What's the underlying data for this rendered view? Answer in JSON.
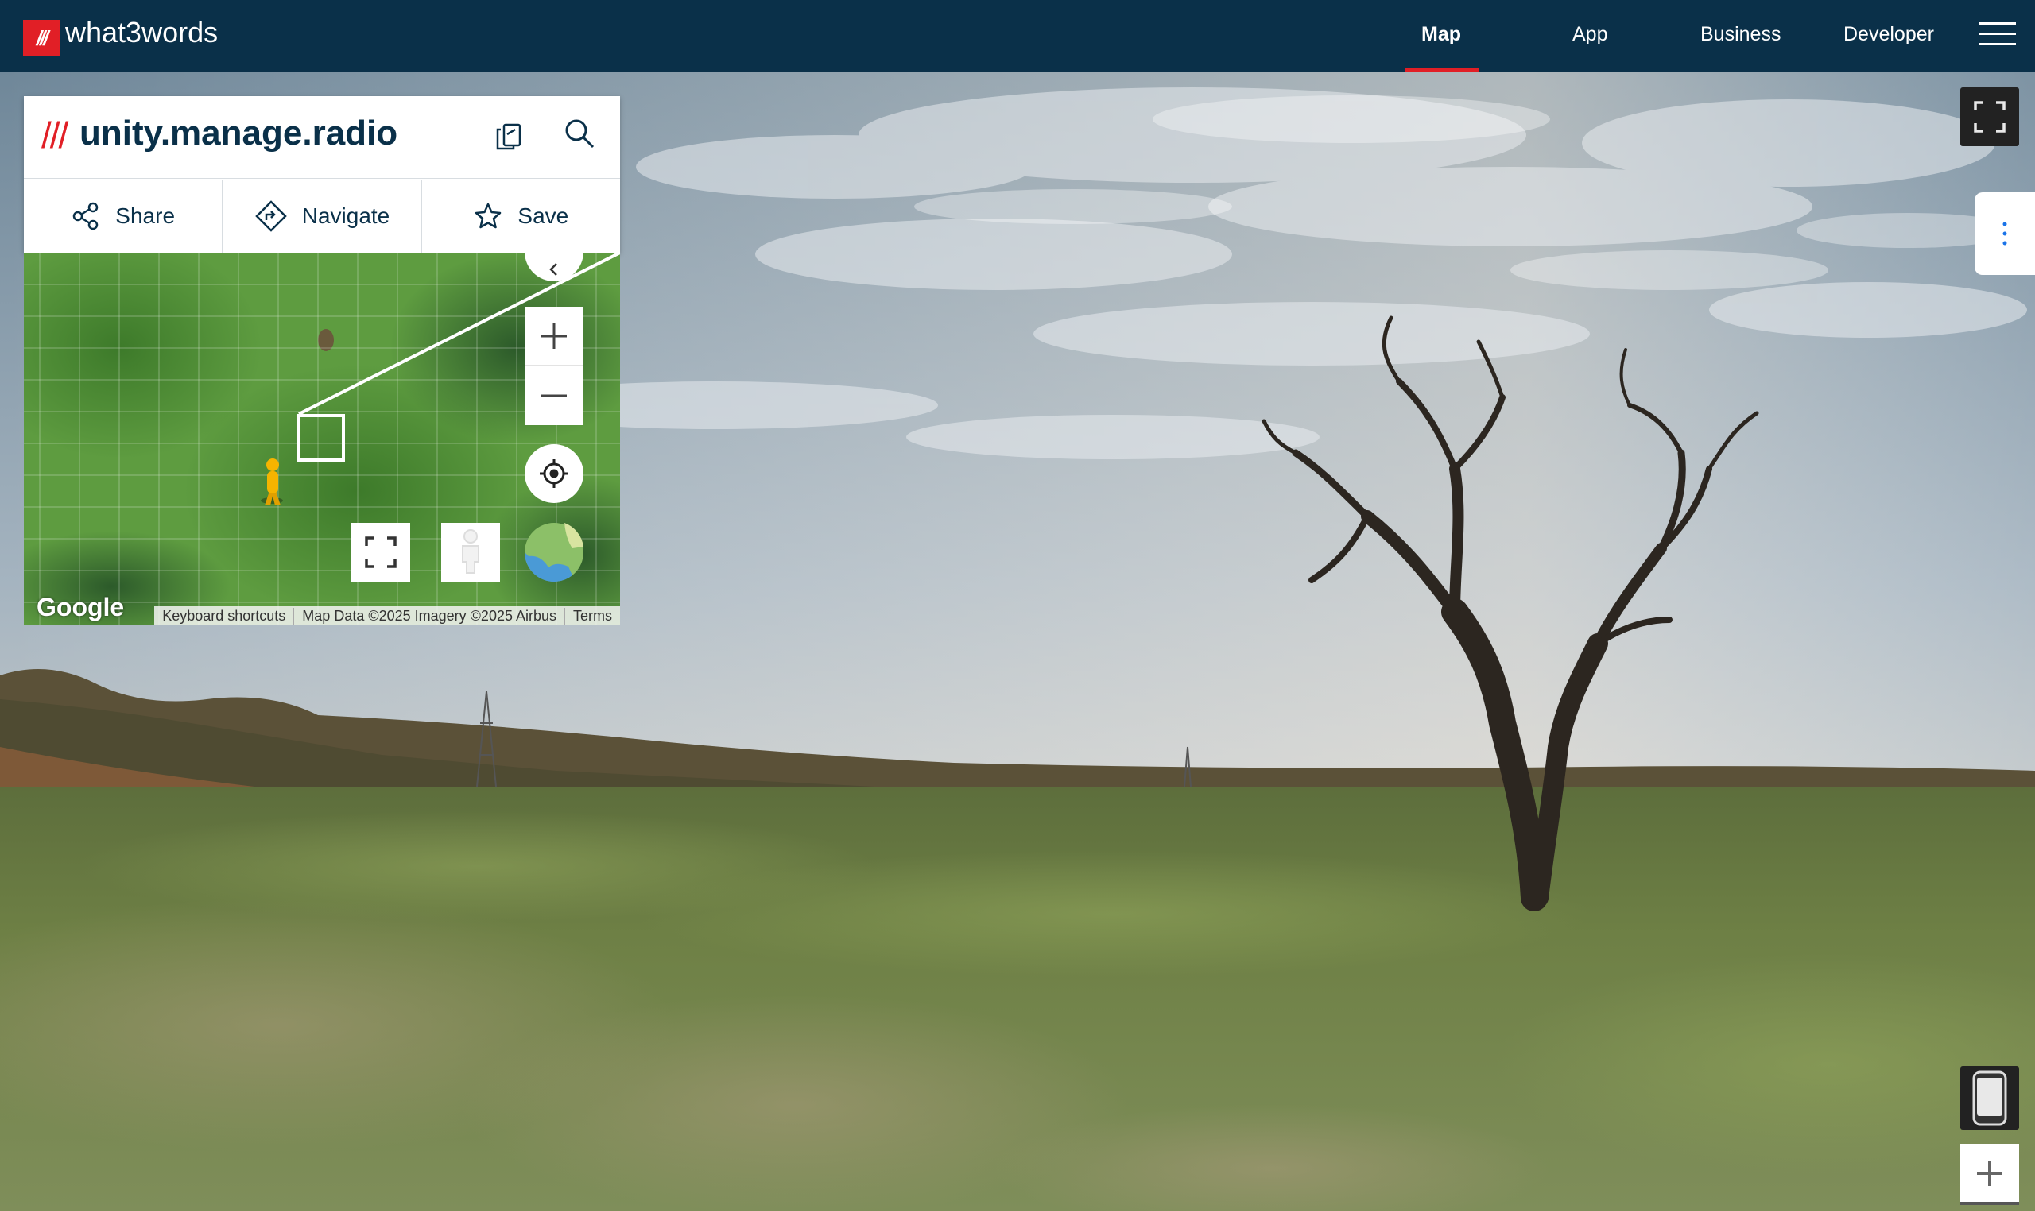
{
  "brand": {
    "badge": "///",
    "name": "what3words"
  },
  "nav": {
    "items": [
      {
        "label": "Map",
        "active": true
      },
      {
        "label": "App",
        "active": false
      },
      {
        "label": "Business",
        "active": false
      },
      {
        "label": "Developer",
        "active": false
      }
    ],
    "menu_icon": "hamburger-icon"
  },
  "location": {
    "slashes": "///",
    "words": "unity.manage.radio",
    "copy_icon": "copy-icon",
    "search_icon": "search-icon"
  },
  "actions": [
    {
      "label": "Share",
      "icon": "share-icon"
    },
    {
      "label": "Navigate",
      "icon": "navigate-icon"
    },
    {
      "label": "Save",
      "icon": "star-icon"
    }
  ],
  "minimap": {
    "google_logo": "Google",
    "attribution": [
      "Keyboard shortcuts",
      "Map Data ©2025 Imagery ©2025 Airbus",
      "Terms"
    ]
  },
  "colors": {
    "header": "#0a3049",
    "accent": "#e11f26"
  }
}
